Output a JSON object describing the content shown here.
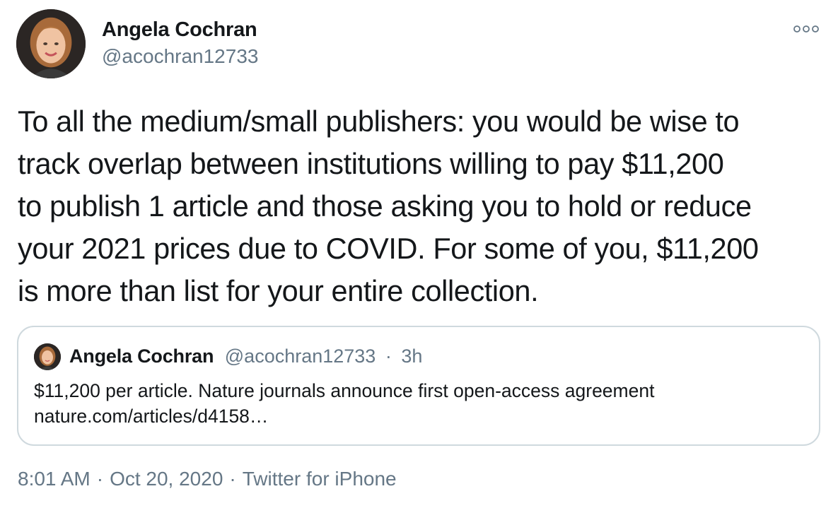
{
  "author": {
    "name": "Angela Cochran",
    "handle": "@acochran12733"
  },
  "more_icon": "more-horizontal-icon",
  "tweet": {
    "lines": [
      "To all the medium/small publishers: you would be wise to",
      "track overlap between institutions willing to pay $11,200",
      "to publish 1 article and those asking you to hold or reduce",
      "your 2021 prices due to COVID. For some of you, $11,200",
      "is more than list for your entire collection."
    ]
  },
  "quoted_tweet": {
    "name": "Angela Cochran",
    "handle": "@acochran12733",
    "separator": "·",
    "age": "3h",
    "lines": [
      "$11,200 per article. Nature journals announce first open-access agreement",
      "nature.com/articles/d4158…"
    ]
  },
  "footer": {
    "time": "8:01 AM",
    "separator": "·",
    "date": "Oct 20, 2020",
    "source": "Twitter for iPhone"
  },
  "colors": {
    "text_primary": "#14171a",
    "text_secondary": "#657786",
    "card_border": "#cfd9de"
  }
}
